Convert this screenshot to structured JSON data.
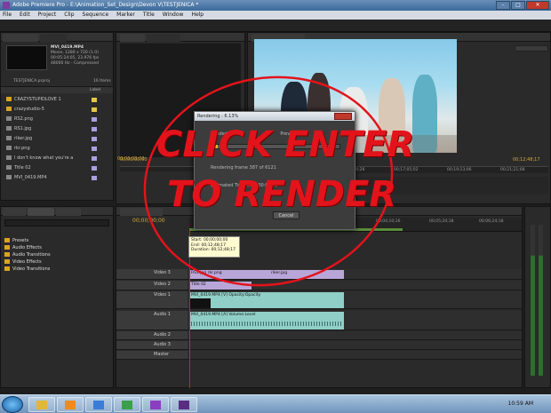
{
  "window": {
    "title": "Adobe Premiere Pro - E:\\Animation_Set_Design\\Devon V\\TESTJENICA *"
  },
  "menu": [
    "File",
    "Edit",
    "Project",
    "Clip",
    "Sequence",
    "Marker",
    "Title",
    "Window",
    "Help"
  ],
  "project": {
    "clip_name": "MVI_0419.MP4",
    "clip_info_1": "Movie, 1280 x 720 (1.0)",
    "clip_info_2": "00:05:24:05, 23.976 fps",
    "clip_info_3": "48000 Hz - Compressed",
    "project_file": "TESTJENICA.prproj",
    "item_count": "16 Items",
    "label_header": "Label",
    "items": [
      {
        "name": "CRAZYSTUPIDLOVE 1",
        "color": "#e6c64a"
      },
      {
        "name": "crazystudio-5",
        "color": "#e6c64a"
      },
      {
        "name": "RS2.png",
        "color": "#a8a0e0"
      },
      {
        "name": "RS1.jpg",
        "color": "#a8a0e0"
      },
      {
        "name": "riker.jpg",
        "color": "#a8a0e0"
      },
      {
        "name": "rkr.png",
        "color": "#a8a0e0"
      },
      {
        "name": "I don't know what you're a",
        "color": "#a8a0e0"
      },
      {
        "name": "Title 02",
        "color": "#a8a0e0"
      },
      {
        "name": "MVI_0419.MP4",
        "color": "#a8a0e0"
      }
    ]
  },
  "program": {
    "tc_left": "00;00;00;00",
    "tc_right": "00;12;48;17",
    "ruler": [
      "00;00;00;00",
      "00;12;48;22",
      "00;14;56;26",
      "00;17;05;02",
      "00;19;13;06",
      "00;21;21;08"
    ]
  },
  "effects": {
    "items": [
      "Presets",
      "Audio Effects",
      "Audio Transitions",
      "Video Effects",
      "Video Transitions"
    ]
  },
  "timeline": {
    "current_tc": "00;00;00;00",
    "ruler": [
      "00;04;10;16",
      "00;05;20;18",
      "00;06;24;18"
    ],
    "tracks": [
      {
        "name": "Video 3"
      },
      {
        "name": "Video 2"
      },
      {
        "name": "Video 1"
      },
      {
        "name": "Audio 1"
      },
      {
        "name": "Audio 2"
      },
      {
        "name": "Audio 3"
      },
      {
        "name": "Master"
      }
    ],
    "clips": {
      "v3_a": "RS1.jpg  rkr.png",
      "v3_b": "riker.jpg",
      "v2": "Title 02",
      "v1": "MVI_0419.MP4 [V]  Opacity:Opacity",
      "a1": "MVI_0419.MP4 [A]  Volume:Level"
    }
  },
  "tooltip": {
    "start": "Start: 00;00;00;00",
    "end": "End: 00;12;48;17",
    "duration": "Duration: 00;12;48;17"
  },
  "dialog": {
    "title": "Rendering : 6.13%",
    "line1": "Rendering 1 of",
    "line1b": "Preview",
    "frame": "Rendering frame 387 of 6121",
    "elapsed": "Estimated Time Left: 00:00:58",
    "cancel": "Cancel",
    "progress": 0.0613
  },
  "annotation": {
    "line1": "CLICK ENTER",
    "line2": "TO RENDER",
    "color": "#e3131b"
  },
  "taskbar": {
    "time": "10:59 AM"
  }
}
